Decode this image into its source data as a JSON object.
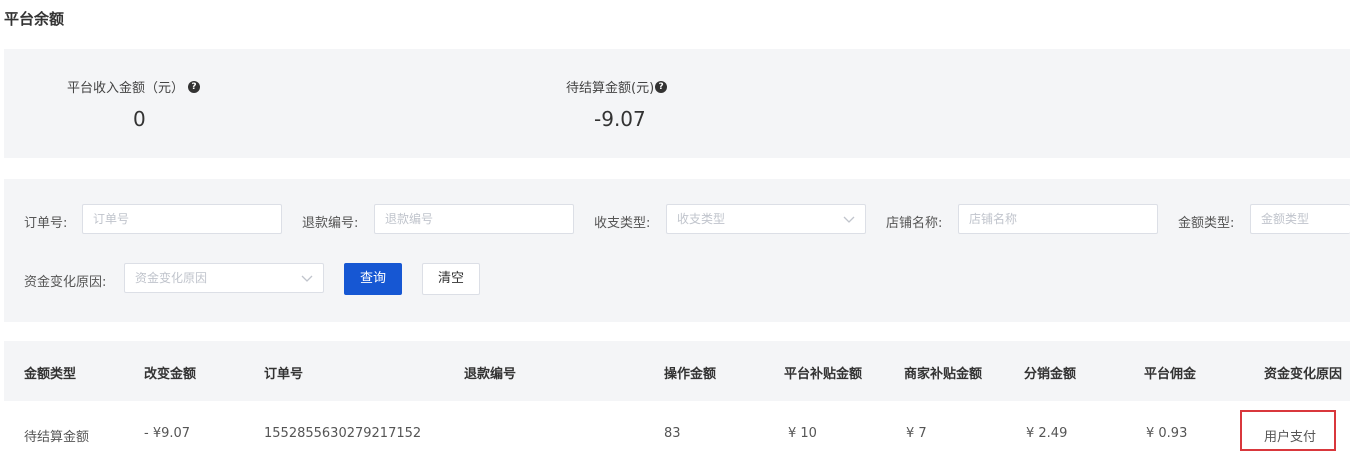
{
  "page": {
    "title": "平台余额"
  },
  "summary": {
    "income_label": "平台收入金额（元）",
    "income_value": "0",
    "pending_label": "待结算金额(元)",
    "pending_value": "-9.07"
  },
  "filters": {
    "order_no": {
      "label": "订单号:",
      "placeholder": "订单号",
      "value": ""
    },
    "refund_no": {
      "label": "退款编号:",
      "placeholder": "退款编号",
      "value": ""
    },
    "io_type": {
      "label": "收支类型:",
      "placeholder": "收支类型"
    },
    "shop_name": {
      "label": "店铺名称:",
      "placeholder": "店铺名称",
      "value": ""
    },
    "amount_type": {
      "label": "金额类型:",
      "placeholder": "金额类型"
    },
    "change_reason": {
      "label": "资金变化原因:",
      "placeholder": "资金变化原因"
    },
    "query_label": "查询",
    "clear_label": "清空"
  },
  "table": {
    "columns": [
      "金额类型",
      "改变金额",
      "订单号",
      "退款编号",
      "操作金额",
      "平台补贴金额",
      "商家补贴金额",
      "分销金额",
      "平台佣金",
      "资金变化原因"
    ],
    "rows": [
      [
        "待结算金额",
        "- ¥9.07",
        "1552855630279217152",
        "",
        "83",
        "¥ 10",
        "¥ 7",
        "¥ 2.49",
        "¥ 0.93",
        "用户支付"
      ]
    ]
  },
  "colors": {
    "primary": "#1657d3",
    "highlight_border": "#d9373c",
    "panel_bg": "#f4f5f7"
  }
}
